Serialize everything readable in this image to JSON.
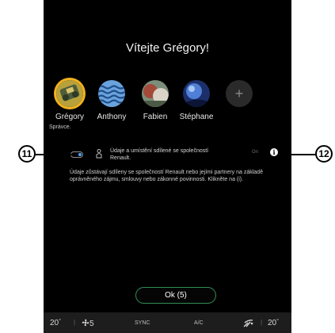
{
  "screen": {
    "title": "Vítejte Grégory!"
  },
  "profiles": [
    {
      "name": "Grégory",
      "role": "Správce."
    },
    {
      "name": "Anthony"
    },
    {
      "name": "Fabien"
    },
    {
      "name": "Stéphane"
    }
  ],
  "add_profile_symbol": "+",
  "consent": {
    "toggle_state": "on",
    "text": "Údaje a umístění sdílené se společností Renault.",
    "on_label": "On",
    "info_symbol": "i"
  },
  "notice": "Údaje zůstávají sdíleny se společností Renault nebo jejími partnery na základě oprávněného zájmu, smlouvy nebo zákonné povinnosti. Klikněte na (i).",
  "ok_button": "Ok (5)",
  "bottom_bar": {
    "left_temp": "20",
    "left_temp_unit": "°",
    "fan_level": "5",
    "sync": "SYNC",
    "ac": "A/C",
    "right_temp": "20",
    "right_temp_unit": "°"
  },
  "callouts": {
    "left": "11",
    "right": "12"
  },
  "colors": {
    "background": "#000000",
    "selected_ring": "#f3b21e",
    "ok_border": "#2f8f55",
    "toggle_knob": "#4da8ff"
  }
}
